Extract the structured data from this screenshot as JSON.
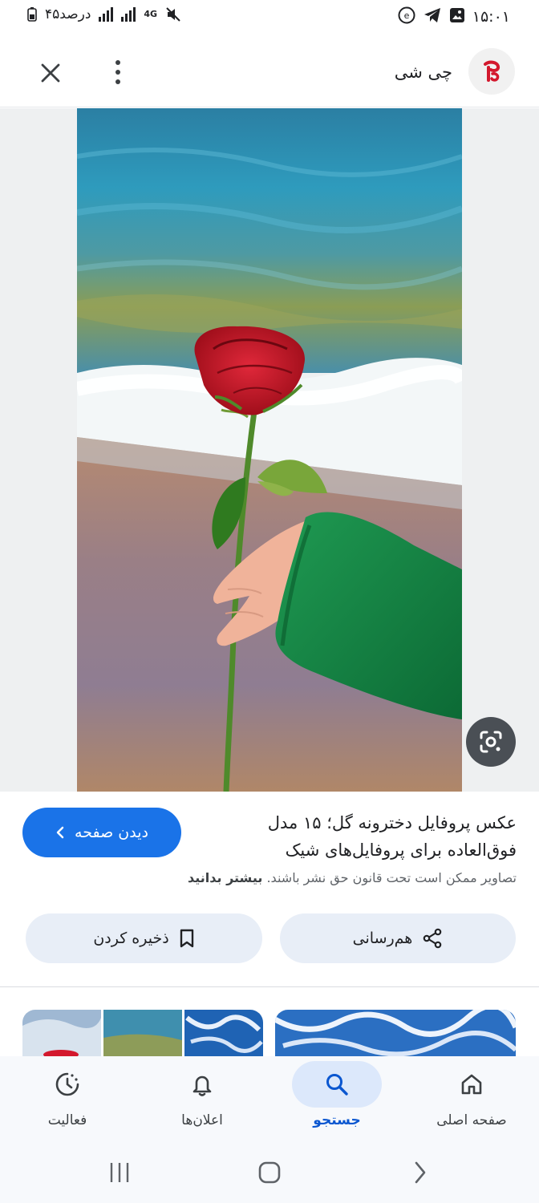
{
  "status_bar": {
    "time": "۱۵:۰۱",
    "battery_text": "۴۵درصد",
    "network": "4G"
  },
  "header": {
    "site_name": "چی شی",
    "logo_icon": "site-logo",
    "more_icon": "more-vert-icon",
    "close_icon": "close-icon"
  },
  "image": {
    "lens_icon": "google-lens-icon"
  },
  "result": {
    "title": "عکس پروفایل دخترونه گل؛ ۱۵ مدل فوق‌العاده برای پروفایل‌های شیک",
    "visit_label": "دیدن صفحه",
    "copyright_text": "تصاویر ممکن است تحت قانون حق نشر باشند.",
    "learn_more": "بیشتر بدانید",
    "share_label": "هم‌رسانی",
    "save_label": "ذخیره کردن"
  },
  "bottom_nav": {
    "items": [
      {
        "label": "صفحه اصلی",
        "icon": "home-icon"
      },
      {
        "label": "جستجو",
        "icon": "search-icon",
        "active": true
      },
      {
        "label": "اعلان‌ها",
        "icon": "bell-icon"
      },
      {
        "label": "فعالیت",
        "icon": "activity-icon"
      }
    ]
  },
  "colors": {
    "accent": "#1a73e8",
    "active_nav": "#0b57d0",
    "chip_bg": "#e8eef7"
  }
}
